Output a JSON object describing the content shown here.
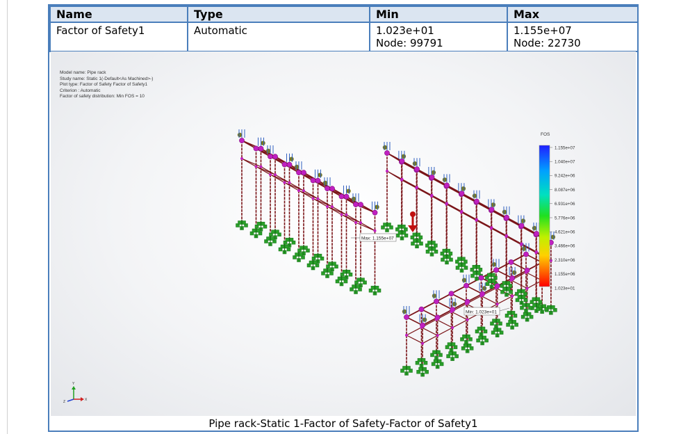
{
  "table": {
    "headers": [
      "Name",
      "Type",
      "Min",
      "Max"
    ],
    "row": {
      "name": "Factor of Safety1",
      "type": "Automatic",
      "min_value": "1.023e+01",
      "min_node": "Node: 99791",
      "max_value": "1.155e+07",
      "max_node": "Node: 22730"
    }
  },
  "plot_info": {
    "model_name": "Model name: Pipe rack",
    "study_name": "Study name: Static 1(-Default<As Machined>-)",
    "plot_type": "Plot type: Factor of Safety Factor of Safety1",
    "criterion": "Criterion : Automatic",
    "distribution": "Factor of safety distribution: Min FOS = 10"
  },
  "legend": {
    "title": "FOS",
    "ticks": [
      "1.155e+07",
      "1.040e+07",
      "9.242e+06",
      "8.087e+06",
      "6.931e+06",
      "5.776e+06",
      "4.621e+06",
      "3.466e+06",
      "2.310e+06",
      "1.155e+06",
      "1.023e+01"
    ]
  },
  "annotations": {
    "max_label": "Max: 1.155e+07",
    "min_label": "Min: 1.023e+01"
  },
  "triad": {
    "y": "Y",
    "x": "X",
    "z": "Z"
  },
  "caption": "Pipe rack-Static 1-Factor of Safety-Factor of Safety1",
  "colors": {
    "border": "#4a7ebb",
    "header_bg": "#dbe5f1",
    "beam": "#7a1418",
    "node": "#c020c0",
    "support": "#2aa02a",
    "load_arrow": "#3060c0"
  }
}
